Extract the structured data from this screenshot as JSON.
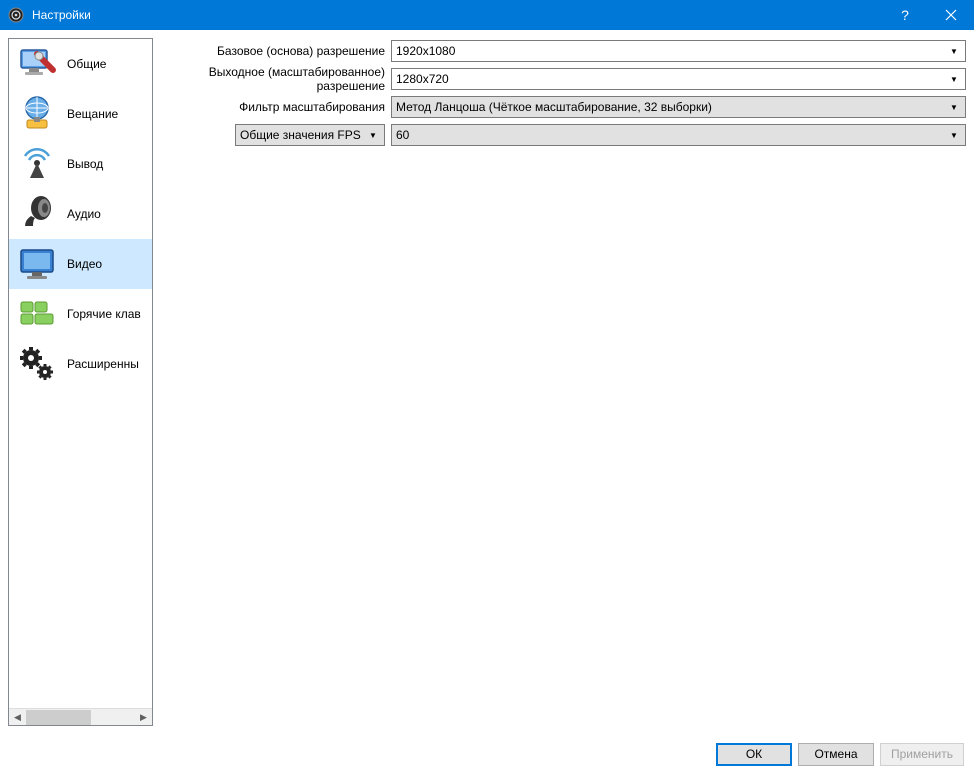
{
  "window": {
    "title": "Настройки"
  },
  "sidebar": {
    "items": [
      {
        "label": "Общие"
      },
      {
        "label": "Вещание"
      },
      {
        "label": "Вывод"
      },
      {
        "label": "Аудио"
      },
      {
        "label": "Видео"
      },
      {
        "label": "Горячие клав"
      },
      {
        "label": "Расширенны"
      }
    ],
    "selected_index": 4
  },
  "video": {
    "base_res_label": "Базовое (основа) разрешение",
    "base_res_value": "1920x1080",
    "output_res_label": "Выходное (масштабированное) разрешение",
    "output_res_value": "1280x720",
    "scale_filter_label": "Фильтр масштабирования",
    "scale_filter_value": "Метод Ланцоша (Чёткое масштабирование, 32 выборки)",
    "fps_type_label": "Общие значения FPS",
    "fps_value": "60"
  },
  "buttons": {
    "ok": "ОК",
    "cancel": "Отмена",
    "apply": "Применить"
  }
}
